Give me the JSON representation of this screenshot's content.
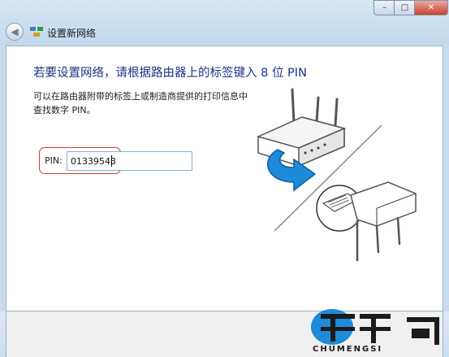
{
  "window": {
    "title": "设置新网络",
    "controls": [
      "minimize-icon",
      "maximize-icon",
      "close-icon"
    ]
  },
  "main": {
    "heading": "若要设置网络，请根据路由器上的标签键入 8 位 PIN",
    "description": "可以在路由器附带的标签上或制造商提供的打印信息中查找数字 PIN。",
    "pin_label": "PIN:",
    "pin_value": "01339543"
  },
  "colors": {
    "heading": "#1e3287",
    "highlight": "#c5403b",
    "arrow": "#1e8bd8"
  },
  "watermark": {
    "text": "CHUMENGSI"
  }
}
